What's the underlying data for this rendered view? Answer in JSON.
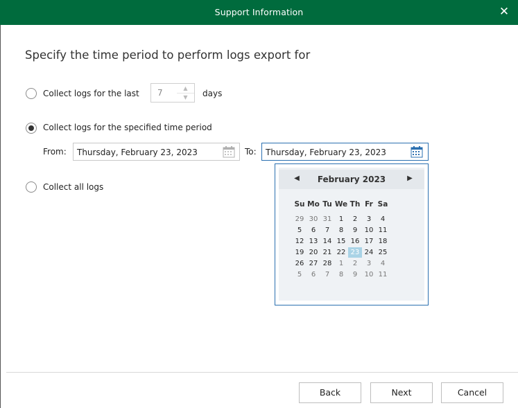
{
  "window": {
    "title": "Support Information",
    "close_glyph": "✕"
  },
  "heading": "Specify the time period to perform logs export for",
  "options": {
    "last": {
      "label": "Collect logs for the last",
      "value": "7",
      "suffix": "days",
      "selected": false
    },
    "period": {
      "label": "Collect logs for the specified time period",
      "selected": true
    },
    "all": {
      "label": "Collect all logs",
      "selected": false
    }
  },
  "period": {
    "from_label": "From:",
    "from_value": "Thursday, February 23, 2023",
    "to_label": "To:",
    "to_value": "Thursday, February 23, 2023"
  },
  "calendar": {
    "month_label": "February 2023",
    "prev_glyph": "◀",
    "next_glyph": "▶",
    "weekdays": [
      "Su",
      "Mo",
      "Tu",
      "We",
      "Th",
      "Fr",
      "Sa"
    ],
    "weeks": [
      [
        "29",
        "30",
        "31",
        "1",
        "2",
        "3",
        "4"
      ],
      [
        "5",
        "6",
        "7",
        "8",
        "9",
        "10",
        "11"
      ],
      [
        "12",
        "13",
        "14",
        "15",
        "16",
        "17",
        "18"
      ],
      [
        "19",
        "20",
        "21",
        "22",
        "23",
        "24",
        "25"
      ],
      [
        "26",
        "27",
        "28",
        "1",
        "2",
        "3",
        "4"
      ],
      [
        "5",
        "6",
        "7",
        "8",
        "9",
        "10",
        "11"
      ]
    ],
    "selected": "23",
    "accent": "#a9d3e6"
  },
  "buttons": {
    "back": "Back",
    "next": "Next",
    "cancel": "Cancel"
  },
  "colors": {
    "titlebar": "#006b3d",
    "focus_border": "#2a6fb0"
  }
}
